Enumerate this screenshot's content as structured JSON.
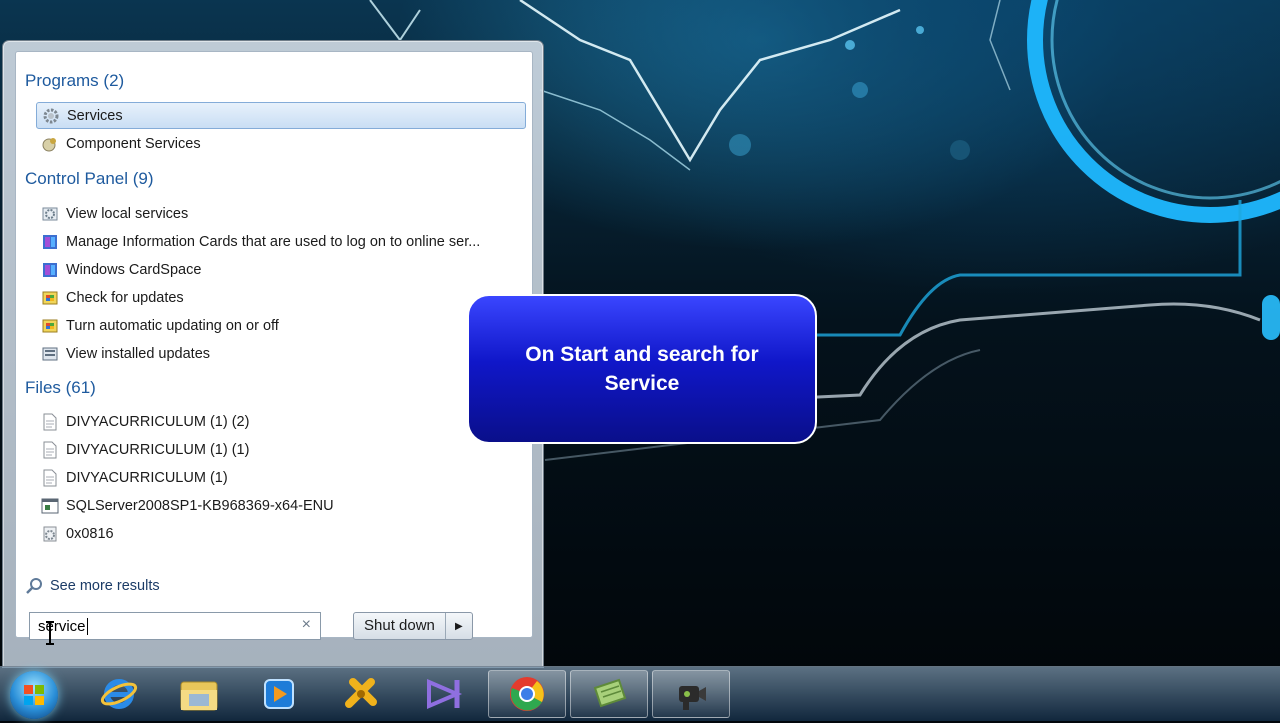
{
  "callout": {
    "text": "On Start and search for Service"
  },
  "start_menu": {
    "groups": [
      {
        "heading": "Programs (2)",
        "items": [
          {
            "label": "Services",
            "icon": "gear-icon",
            "selected": true
          },
          {
            "label": "Component Services",
            "icon": "component-services-icon"
          }
        ]
      },
      {
        "heading": "Control Panel (9)",
        "items": [
          {
            "label": "View local services",
            "icon": "services-control-icon"
          },
          {
            "label": "Manage Information Cards that are used to log on to online ser...",
            "icon": "cardspace-icon"
          },
          {
            "label": "Windows CardSpace",
            "icon": "cardspace-icon"
          },
          {
            "label": "Check for updates",
            "icon": "windows-update-icon"
          },
          {
            "label": "Turn automatic updating on or off",
            "icon": "windows-update-icon"
          },
          {
            "label": "View installed updates",
            "icon": "installed-updates-icon"
          }
        ]
      },
      {
        "heading": "Files (61)",
        "items": [
          {
            "label": "DIVYACURRICULUM (1) (2)",
            "icon": "document-icon"
          },
          {
            "label": "DIVYACURRICULUM (1) (1)",
            "icon": "document-icon"
          },
          {
            "label": "DIVYACURRICULUM (1)",
            "icon": "document-icon"
          },
          {
            "label": "SQLServer2008SP1-KB968369-x64-ENU",
            "icon": "application-icon"
          },
          {
            "label": "0x0816",
            "icon": "settings-file-icon"
          }
        ]
      }
    ],
    "see_more": "See more results",
    "search": {
      "value": "service"
    },
    "shutdown_label": "Shut down"
  },
  "taskbar": {
    "pinned": [
      {
        "name": "internet-explorer-icon"
      },
      {
        "name": "windows-explorer-icon"
      },
      {
        "name": "media-player-icon"
      },
      {
        "name": "tools-app-icon"
      },
      {
        "name": "visual-studio-icon"
      },
      {
        "name": "chrome-icon",
        "active": true
      },
      {
        "name": "notes-app-icon",
        "active": true
      },
      {
        "name": "camcorder-app-icon",
        "active": true
      }
    ]
  },
  "colors": {
    "heading": "#1e5a9e",
    "callout": "#1017c9",
    "selection": "#c9def4"
  }
}
